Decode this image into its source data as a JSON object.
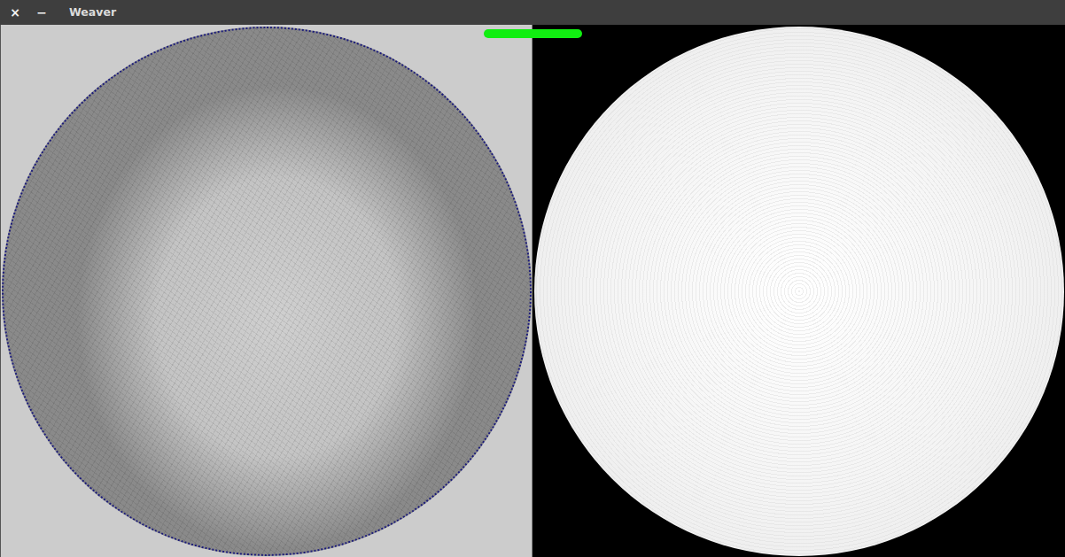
{
  "window": {
    "title": "Weaver"
  },
  "controls": [
    {
      "label": "×"
    },
    {
      "label": "−"
    }
  ],
  "progress": {
    "level": 1
  }
}
